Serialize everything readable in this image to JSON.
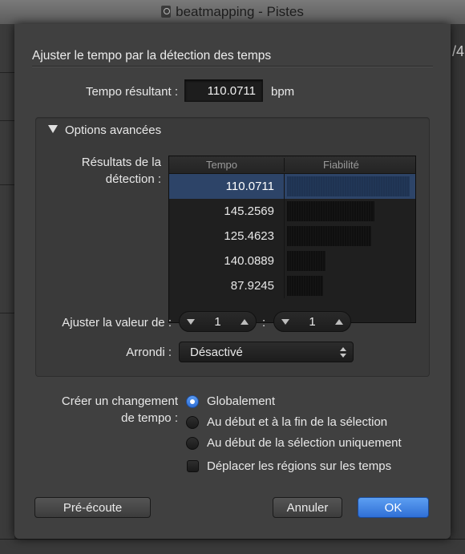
{
  "window": {
    "title": "beatmapping - Pistes",
    "right_digits": "/4"
  },
  "dialog": {
    "title": "Ajuster le tempo par la détection des temps",
    "resulting_tempo": {
      "label": "Tempo résultant :",
      "value": "110.0711",
      "unit": "bpm"
    },
    "advanced": {
      "label": "Options avancées",
      "results_label_line1": "Résultats de la",
      "results_label_line2": "détection :",
      "table": {
        "headers": [
          "Tempo",
          "Fiabilité"
        ],
        "rows": [
          {
            "tempo": "110.0711",
            "reliability": 0.98,
            "selected": true
          },
          {
            "tempo": "145.2569",
            "reliability": 0.7,
            "selected": false
          },
          {
            "tempo": "125.4623",
            "reliability": 0.67,
            "selected": false
          },
          {
            "tempo": "140.0889",
            "reliability": 0.31,
            "selected": false
          },
          {
            "tempo": "87.9245",
            "reliability": 0.29,
            "selected": false
          }
        ]
      },
      "adjust_label": "Ajuster la valeur de :",
      "adjust_a": "1",
      "adjust_separator": ":",
      "adjust_b": "1",
      "rounding_label": "Arrondi :",
      "rounding_value": "Désactivé"
    },
    "create_change": {
      "label_line1": "Créer un changement",
      "label_line2": "de tempo :",
      "options": [
        {
          "label": "Globalement",
          "selected": true
        },
        {
          "label": "Au début et à la fin de la sélection",
          "selected": false
        },
        {
          "label": "Au début de la sélection uniquement",
          "selected": false
        }
      ],
      "move_regions_label": "Déplacer les régions sur les temps",
      "move_regions_checked": false
    },
    "buttons": {
      "preview": "Pré-écoute",
      "cancel": "Annuler",
      "ok": "OK"
    }
  },
  "colors": {
    "accent": "#3a7ee0",
    "selection": "#2d4468",
    "dialog_bg": "#404040"
  },
  "icons": [
    "document-icon",
    "disclosure-triangle-icon",
    "stepper-down-icon",
    "stepper-up-icon",
    "popup-arrows-icon"
  ]
}
